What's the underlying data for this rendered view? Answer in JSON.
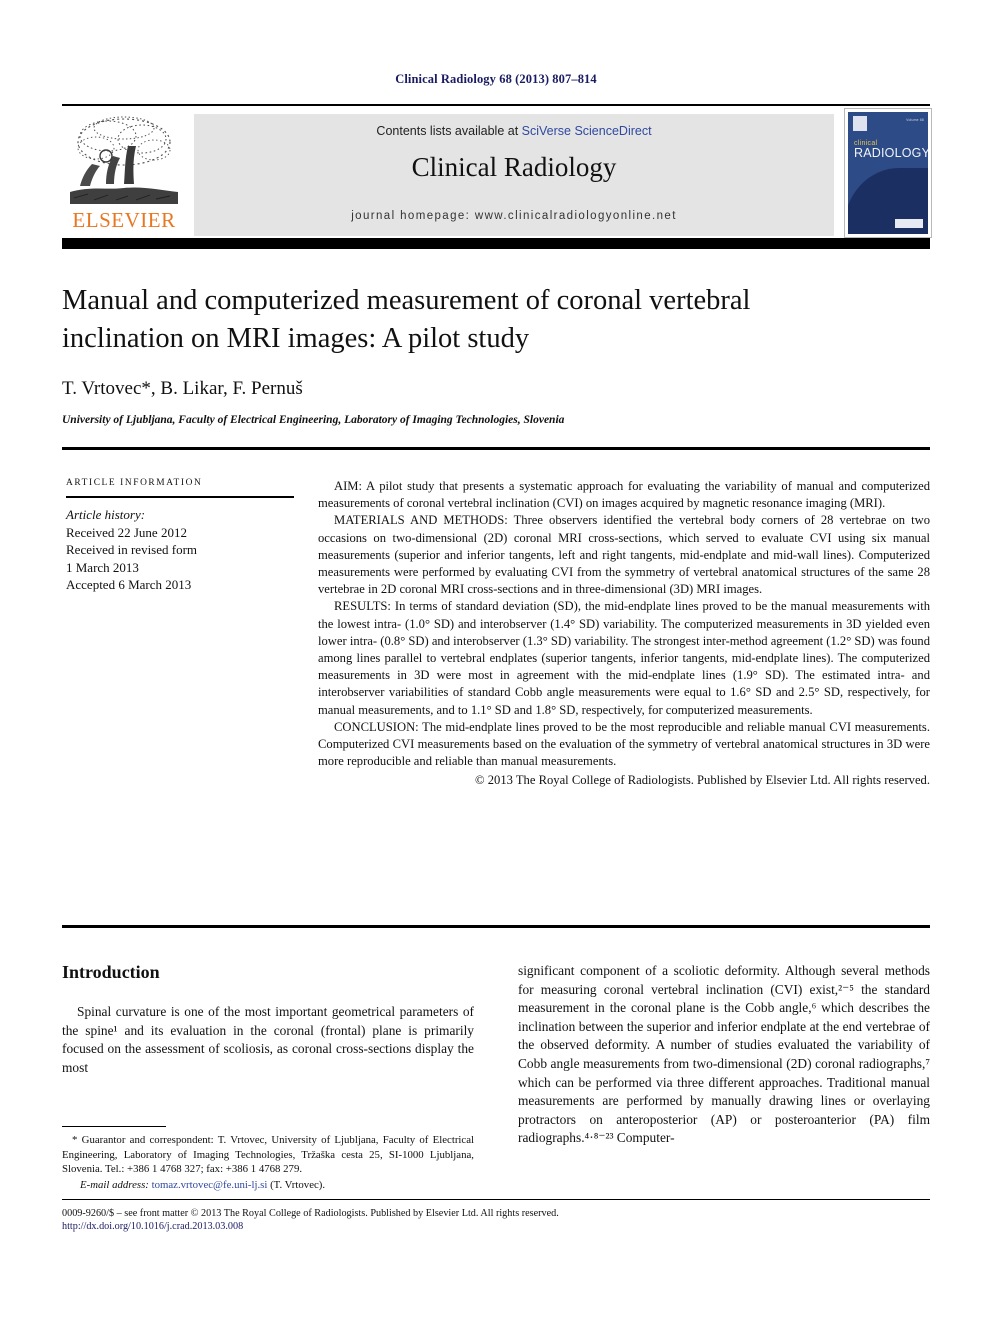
{
  "running_head": "Clinical Radiology 68 (2013) 807–814",
  "masthead": {
    "publisher_wordmark": "ELSEVIER",
    "contents_prefix": "Contents lists available at ",
    "contents_link": "SciVerse ScienceDirect",
    "journal_title": "Clinical Radiology",
    "homepage": "journal homepage: www.clinicalradiologyonline.net",
    "cover": {
      "line1": "clinical",
      "line2": "RADIOLOGY",
      "corner_note": "Volume 68"
    },
    "colors": {
      "elsevier_orange": "#e87722",
      "link_blue": "#2f49a0",
      "banner_grey": "#e4e4e4",
      "cover_navy": "#2d4b86",
      "running_head_navy": "#1b1b63"
    }
  },
  "article": {
    "title": "Manual and computerized measurement of coronal vertebral inclination on MRI images: A pilot study",
    "authors": "T. Vrtovec*, B. Likar, F. Pernuš",
    "author_marker": "*",
    "affiliation": "University of Ljubljana, Faculty of Electrical Engineering, Laboratory of Imaging Technologies, Slovenia"
  },
  "article_information": {
    "heading": "Article information",
    "history_label": "Article history:",
    "history": [
      "Received 22 June 2012",
      "Received in revised form",
      "1 March 2013",
      "Accepted 6 March 2013"
    ]
  },
  "abstract": {
    "aim": "AIM: A pilot study that presents a systematic approach for evaluating the variability of manual and computerized measurements of coronal vertebral inclination (CVI) on images acquired by magnetic resonance imaging (MRI).",
    "materials": "MATERIALS AND METHODS: Three observers identified the vertebral body corners of 28 vertebrae on two occasions on two-dimensional (2D) coronal MRI cross-sections, which served to evaluate CVI using six manual measurements (superior and inferior tangents, left and right tangents, mid-endplate and mid-wall lines). Computerized measurements were performed by evaluating CVI from the symmetry of vertebral anatomical structures of the same 28 vertebrae in 2D coronal MRI cross-sections and in three-dimensional (3D) MRI images.",
    "results": "RESULTS: In terms of standard deviation (SD), the mid-endplate lines proved to be the manual measurements with the lowest intra- (1.0° SD) and interobserver (1.4° SD) variability. The computerized measurements in 3D yielded even lower intra- (0.8° SD) and interobserver (1.3° SD) variability. The strongest inter-method agreement (1.2° SD) was found among lines parallel to vertebral endplates (superior tangents, inferior tangents, mid-endplate lines). The computerized measurements in 3D were most in agreement with the mid-endplate lines (1.9° SD). The estimated intra- and interobserver variabilities of standard Cobb angle measurements were equal to 1.6° SD and 2.5° SD, respectively, for manual measurements, and to 1.1° SD and 1.8° SD, respectively, for computerized measurements.",
    "conclusion": "CONCLUSION: The mid-endplate lines proved to be the most reproducible and reliable manual CVI measurements. Computerized CVI measurements based on the evaluation of the symmetry of vertebral anatomical structures in 3D were more reproducible and reliable than manual measurements.",
    "copyright": "© 2013 The Royal College of Radiologists. Published by Elsevier Ltd. All rights reserved."
  },
  "body": {
    "section_heading": "Introduction",
    "left_paragraph": "Spinal curvature is one of the most important geometrical parameters of the spine¹ and its evaluation in the coronal (frontal) plane is primarily focused on the assessment of scoliosis, as coronal cross-sections display the most",
    "right_paragraph": "significant component of a scoliotic deformity. Although several methods for measuring coronal vertebral inclination (CVI) exist,²⁻⁵ the standard measurement in the coronal plane is the Cobb angle,⁶ which describes the inclination between the superior and inferior endplate at the end vertebrae of the observed deformity. A number of studies evaluated the variability of Cobb angle measurements from two-dimensional (2D) coronal radiographs,⁷ which can be performed via three different approaches. Traditional manual measurements are performed by manually drawing lines or overlaying protractors on anteroposterior (AP) or posteroanterior (PA) film radiographs.⁴·⁸⁻²³ Computer-"
  },
  "footnote": {
    "line1": "* Guarantor and correspondent: T. Vrtovec, University of Ljubljana, Faculty of Electrical Engineering, Laboratory of Imaging Technologies, Tržaška cesta 25, SI-1000 Ljubljana, Slovenia. Tel.: +386 1 4768 327; fax: +386 1 4768 279.",
    "email_label": "E-mail address:",
    "email": "tomaz.vrtovec@fe.uni-lj.si",
    "email_suffix": "(T. Vrtovec)."
  },
  "bottom": {
    "frontmatter": "0009-9260/$ – see front matter © 2013 The Royal College of Radiologists. Published by Elsevier Ltd. All rights reserved.",
    "doi": "http://dx.doi.org/10.1016/j.crad.2013.03.008"
  }
}
